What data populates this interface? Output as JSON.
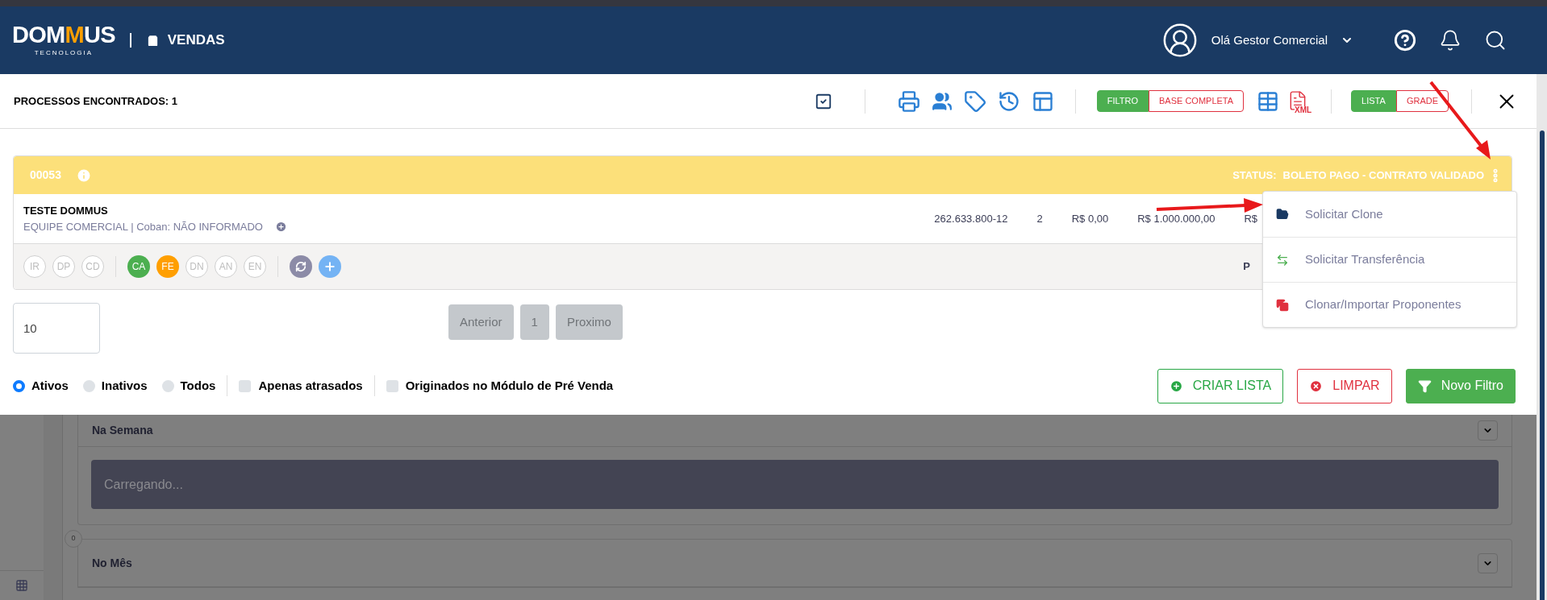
{
  "header": {
    "logo": "DOMMUS",
    "logo_subtitle": "TECNOLOGIA",
    "module": "VENDAS",
    "user_greeting": "Olá Gestor Comercial"
  },
  "toolbar": {
    "title": "PROCESSOS ENCONTRADOS: 1",
    "scope_toggle": [
      {
        "label": "FILTRO",
        "selected": true
      },
      {
        "label": "BASE COMPLETA",
        "selected": false
      }
    ],
    "export_label": "XML",
    "view_toggle": [
      {
        "label": "LISTA",
        "selected": true
      },
      {
        "label": "GRADE",
        "selected": false
      }
    ]
  },
  "process": {
    "id": "00053",
    "status_label": "STATUS:",
    "status": "BOLETO PAGO - CONTRATO VALIDADO",
    "client": "TESTE DOMMUS",
    "team": "EQUIPE COMERCIAL | Coban: NÃO INFORMADO",
    "columns": [
      "262.633.800-12",
      "2",
      "R$ 0,00",
      "R$ 1.000.000,00",
      "R$"
    ],
    "stage_groups": [
      [
        {
          "label": "IR"
        },
        {
          "label": "DP"
        },
        {
          "label": "CD"
        }
      ],
      [
        {
          "label": "CA",
          "color": "#4caf50"
        },
        {
          "label": "FE",
          "color": "#ff9f00"
        },
        {
          "label": "DN"
        },
        {
          "label": "AN"
        },
        {
          "label": "EN"
        }
      ]
    ],
    "footer_text": "P"
  },
  "menu": {
    "items": [
      {
        "label": "Solicitar Clone",
        "kind": "clone"
      },
      {
        "label": "Solicitar Transferência",
        "kind": "transfer"
      },
      {
        "label": "Clonar/Importar Proponentes",
        "kind": "copy"
      }
    ]
  },
  "pagination": {
    "page_size": "10",
    "buttons": [
      "Anterior",
      "1",
      "Proximo"
    ]
  },
  "filters": {
    "status": [
      {
        "label": "Ativos",
        "selected": true
      },
      {
        "label": "Inativos",
        "selected": false
      },
      {
        "label": "Todos",
        "selected": false
      }
    ],
    "checks": [
      {
        "label": "Apenas atrasados",
        "checked": false
      },
      {
        "label": "Originados no Módulo de Pré Venda",
        "checked": false
      }
    ]
  },
  "actions": [
    {
      "label": "CRIAR LISTA",
      "kind": "create"
    },
    {
      "label": "LIMPAR",
      "kind": "clear"
    },
    {
      "label": "Novo Filtro",
      "kind": "filter"
    }
  ],
  "background": {
    "sections": [
      {
        "title": "Na Semana",
        "content": "Carregando..."
      },
      {
        "title": "No Mês",
        "badge": "0"
      }
    ]
  }
}
